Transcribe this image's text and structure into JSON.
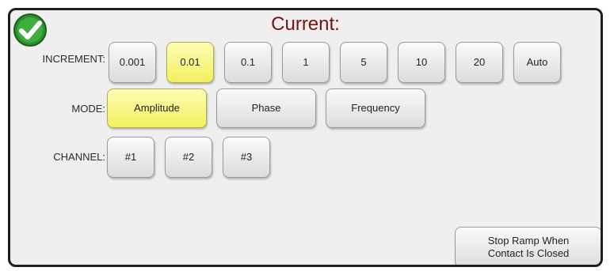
{
  "header": {
    "title": "Current:",
    "status_icon": "green-check-icon"
  },
  "colors": {
    "selected": "#f6f36a",
    "title": "#7a1010",
    "ok_green": "#2e9c2e"
  },
  "increment": {
    "label": "INCREMENT:",
    "options": [
      "0.001",
      "0.01",
      "0.1",
      "1",
      "5",
      "10",
      "20",
      "Auto"
    ],
    "selected": "0.01"
  },
  "mode": {
    "label": "MODE:",
    "options": [
      "Amplitude",
      "Phase",
      "Frequency"
    ],
    "selected": "Amplitude"
  },
  "channel": {
    "label": "CHANNEL:",
    "options": [
      "#1",
      "#2",
      "#3"
    ]
  },
  "stop_ramp": {
    "line1": "Stop Ramp When",
    "line2": "Contact Is Closed"
  }
}
